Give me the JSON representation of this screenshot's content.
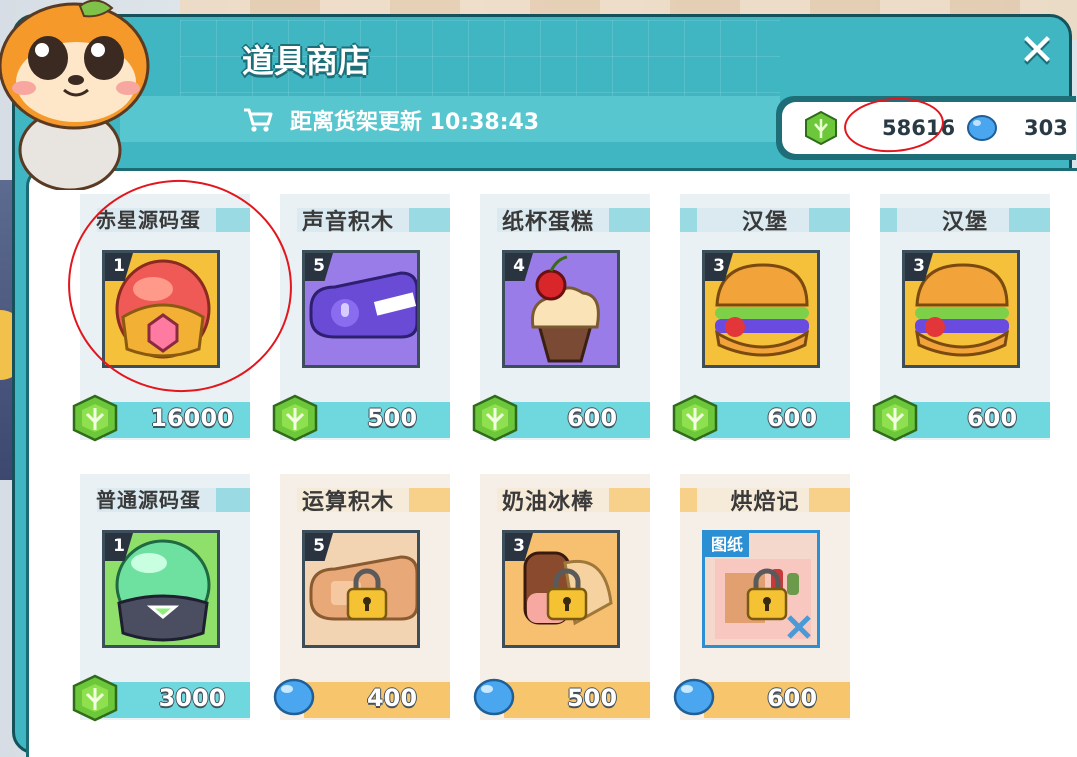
{
  "shop": {
    "title": "道具商店",
    "close_label": "✕",
    "refresh_text": "距离货架更新 10:38:43"
  },
  "currency": {
    "gems": "58616",
    "beans": "303"
  },
  "colors": {
    "teal": "#3fb6c1",
    "cyan_bar": "#6fd8de",
    "orange_bar": "#f7c56c",
    "gem_green": "#7bd13a",
    "bean_blue": "#4aa6ee"
  },
  "items": [
    {
      "name": "赤星源码蛋",
      "level": "1",
      "price": "16000",
      "currency": "gem",
      "locked": false
    },
    {
      "name": "声音积木",
      "level": "5",
      "price": "500",
      "currency": "gem",
      "locked": false
    },
    {
      "name": "纸杯蛋糕",
      "level": "4",
      "price": "600",
      "currency": "gem",
      "locked": false
    },
    {
      "name": "汉堡",
      "level": "3",
      "price": "600",
      "currency": "gem",
      "locked": false
    },
    {
      "name": "汉堡",
      "level": "3",
      "price": "600",
      "currency": "gem",
      "locked": false
    },
    {
      "name": "普通源码蛋",
      "level": "1",
      "price": "3000",
      "currency": "gem",
      "locked": false
    },
    {
      "name": "运算积木",
      "level": "5",
      "price": "400",
      "currency": "bean",
      "locked": true
    },
    {
      "name": "奶油冰棒",
      "level": "3",
      "price": "500",
      "currency": "bean",
      "locked": true
    },
    {
      "name": "烘焙记",
      "tag": "图纸",
      "price": "600",
      "currency": "bean",
      "locked": true
    }
  ]
}
